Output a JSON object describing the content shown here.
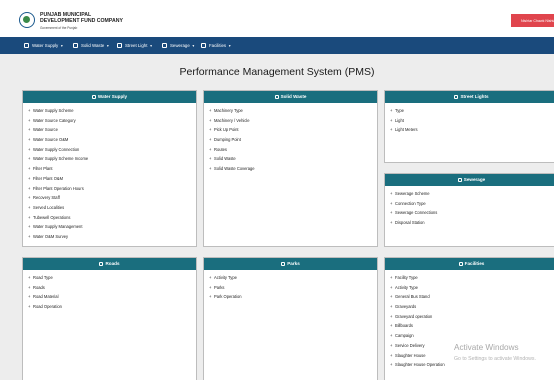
{
  "header": {
    "org_title": "PUNJAB MUNICIPAL DEVELOPMENT FUND COMPANY",
    "org_subtitle": "Government of the Punjab",
    "top_button": "Nishtar Chawk Nishtar"
  },
  "nav": {
    "items": [
      {
        "label": "Water Supply"
      },
      {
        "label": "Solid Waste"
      },
      {
        "label": "Street Light"
      },
      {
        "label": "Sewerage"
      },
      {
        "label": "Facilities"
      }
    ]
  },
  "page_title": "Performance Management System (PMS)",
  "panels": {
    "water_supply": {
      "title": "Water Supply",
      "items": [
        "Water Supply Scheme",
        "Water Source Category",
        "Water Source",
        "Water Source O&M",
        "Water Supply Connection",
        "Water Supply Scheme Income",
        "Filter Plant",
        "Filter Plant O&M",
        "Filter Plant Operation Hours",
        "Recovery Staff",
        "Served Localities",
        "Tubewell Operations",
        "Water Supply Management",
        "Water O&M Survey"
      ]
    },
    "solid_waste": {
      "title": "Solid Waste",
      "items": [
        "Machinery Type",
        "Machinery / Vehicle",
        "Pick Up Point",
        "Dumping Point",
        "Routes",
        "Solid Waste",
        "Solid Waste Coverage"
      ]
    },
    "street_lights": {
      "title": "Street Lights",
      "items": [
        "Type",
        "Light",
        "Light Meters"
      ]
    },
    "sewerage": {
      "title": "Sewerage",
      "items": [
        "Sewerage Scheme",
        "Connection Type",
        "Sewerage Connections",
        "Disposal Station"
      ]
    },
    "roads": {
      "title": "Roads",
      "items": [
        "Road Type",
        "Roads",
        "Road Material",
        "Road Operation"
      ]
    },
    "parks": {
      "title": "Parks",
      "items": [
        "Activity Type",
        "Parks",
        "Park Operation"
      ]
    },
    "facilities": {
      "title": "Facilities",
      "items": [
        "Facility Type",
        "Activity Type",
        "General Bus Stand",
        "Graveyards",
        "Graveyard operation",
        "Billboards",
        "Campaign",
        "Service Delivery",
        "Slaughter House",
        "Slaughter House Operation"
      ]
    }
  },
  "watermark": {
    "title": "Activate Windows",
    "subtitle": "Go to Settings to activate Windows."
  },
  "colors": {
    "navbar": "#1a4a7c",
    "panel_header": "#1a6e7e",
    "top_button": "#e0454d",
    "background": "#ededed"
  }
}
